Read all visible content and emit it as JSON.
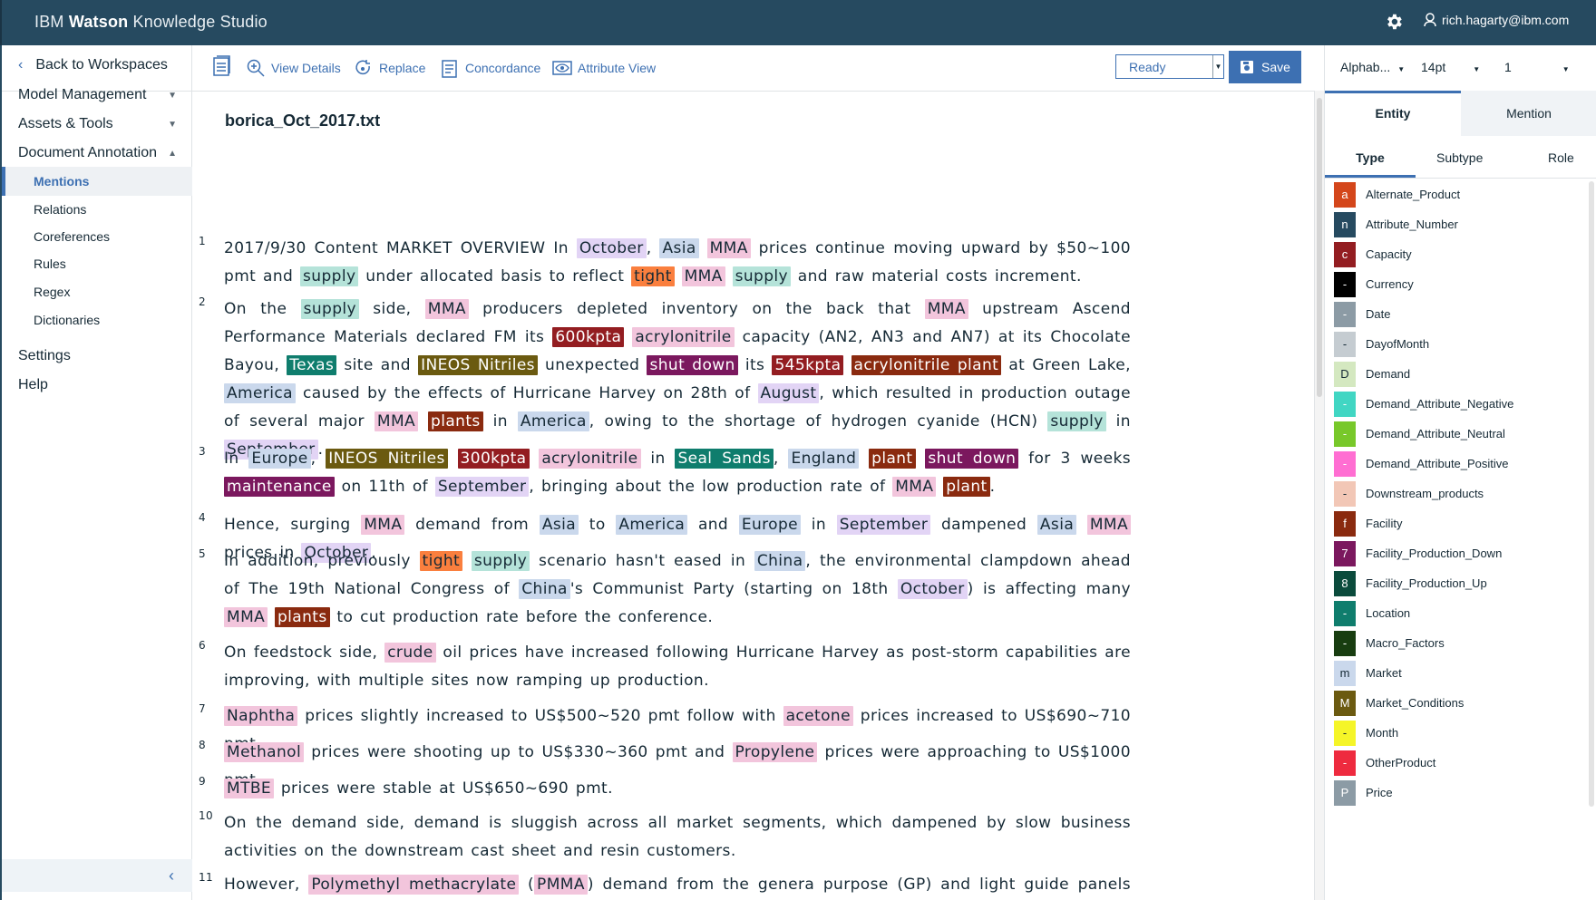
{
  "app": {
    "brand_prefix": "IBM",
    "brand_bold": "Watson",
    "brand_suffix": "Knowledge Studio",
    "user": "rich.hagarty@ibm.com"
  },
  "nav": {
    "back": "Back to Workspaces",
    "sections": [
      {
        "label": "Model Management",
        "expanded": false
      },
      {
        "label": "Assets & Tools",
        "expanded": false
      },
      {
        "label": "Document Annotation",
        "expanded": true
      }
    ],
    "sub_items": [
      "Mentions",
      "Relations",
      "Coreferences",
      "Rules",
      "Regex",
      "Dictionaries"
    ],
    "active_sub": "Mentions",
    "settings": "Settings",
    "help": "Help"
  },
  "toolbar": {
    "view_details": "View Details",
    "replace": "Replace",
    "concordance": "Concordance",
    "attribute_view": "Attribute View",
    "status": "Ready",
    "save": "Save"
  },
  "rp_controls": {
    "sort": "Alphab...",
    "font_size": "14pt",
    "page": "1"
  },
  "rp_tabs": {
    "entity": "Entity",
    "mention": "Mention",
    "type": "Type",
    "subtype": "Subtype",
    "role": "Role"
  },
  "document": {
    "title": "borica_Oct_2017.txt"
  },
  "entity_types": [
    {
      "letter": "a",
      "name": "Alternate_Product",
      "color": "#d4461b"
    },
    {
      "letter": "n",
      "name": "Attribute_Number",
      "color": "#264a60"
    },
    {
      "letter": "c",
      "name": "Capacity",
      "color": "#931d21"
    },
    {
      "letter": "-",
      "name": "Currency",
      "color": "#000000"
    },
    {
      "letter": "-",
      "name": "Date",
      "color": "#8c9ba5"
    },
    {
      "letter": "-",
      "name": "DayofMonth",
      "color": "#c5ccd1"
    },
    {
      "letter": "D",
      "name": "Demand",
      "color": "#d4e8c0"
    },
    {
      "letter": "-",
      "name": "Demand_Attribute_Negative",
      "color": "#41d6c3"
    },
    {
      "letter": "-",
      "name": "Demand_Attribute_Neutral",
      "color": "#78c82a"
    },
    {
      "letter": "-",
      "name": "Demand_Attribute_Positive",
      "color": "#ff6ed2"
    },
    {
      "letter": "-",
      "name": "Downstream_products",
      "color": "#f2c7b6"
    },
    {
      "letter": "f",
      "name": "Facility",
      "color": "#8a2a0f"
    },
    {
      "letter": "7",
      "name": "Facility_Production_Down",
      "color": "#7b185e"
    },
    {
      "letter": "8",
      "name": "Facility_Production_Up",
      "color": "#0b4b3c"
    },
    {
      "letter": "-",
      "name": "Location",
      "color": "#0f7d6d"
    },
    {
      "letter": "-",
      "name": "Macro_Factors",
      "color": "#183d10"
    },
    {
      "letter": "m",
      "name": "Market",
      "color": "#cad8ec"
    },
    {
      "letter": "M",
      "name": "Market_Conditions",
      "color": "#6b5a10"
    },
    {
      "letter": "-",
      "name": "Month",
      "color": "#f5f528"
    },
    {
      "letter": "-",
      "name": "OtherProduct",
      "color": "#ee2b3f"
    },
    {
      "letter": "P",
      "name": "Price",
      "color": "#8c9ba5"
    }
  ],
  "paragraphs": [
    {
      "num": "1",
      "segs": [
        [
          "2017/9/30 Content MARKET OVERVIEW In ",
          ""
        ],
        [
          "October",
          "month"
        ],
        [
          ", ",
          ""
        ],
        [
          "Asia",
          "market"
        ],
        [
          " ",
          ""
        ],
        [
          "MMA",
          "product"
        ],
        [
          " prices continue moving upward by $50~100 pmt and ",
          ""
        ],
        [
          "supply",
          "supply"
        ],
        [
          " under allocated basis to reflect ",
          ""
        ],
        [
          "tight",
          "tight"
        ],
        [
          " ",
          ""
        ],
        [
          "MMA",
          "product"
        ],
        [
          " ",
          ""
        ],
        [
          "supply",
          "supply"
        ],
        [
          " and raw material costs increment.",
          ""
        ]
      ]
    },
    {
      "num": "2",
      "segs": [
        [
          "On the ",
          ""
        ],
        [
          "supply",
          "supply"
        ],
        [
          " side, ",
          ""
        ],
        [
          "MMA",
          "product"
        ],
        [
          " producers depleted inventory on the back that ",
          ""
        ],
        [
          "MMA",
          "product"
        ],
        [
          " upstream Ascend Performance Materials declared FM its ",
          ""
        ],
        [
          "600kpta",
          "capacity"
        ],
        [
          " ",
          ""
        ],
        [
          "acrylonitrile",
          "product"
        ],
        [
          " capacity (AN2, AN3 and AN7) at its Chocolate Bayou, ",
          ""
        ],
        [
          "Texas",
          "location"
        ],
        [
          " site and ",
          ""
        ],
        [
          "INEOS Nitriles",
          "marketcond"
        ],
        [
          " unexpected ",
          ""
        ],
        [
          "shut down",
          "down"
        ],
        [
          " its ",
          ""
        ],
        [
          "545kpta",
          "capacity"
        ],
        [
          " ",
          ""
        ],
        [
          "acrylonitrile plant",
          "facility"
        ],
        [
          " at Green Lake, ",
          ""
        ],
        [
          "America",
          "market"
        ],
        [
          " caused by the effects of Hurricane Harvey on 28th of ",
          ""
        ],
        [
          "August",
          "month"
        ],
        [
          ", which resulted in production outage of several major ",
          ""
        ],
        [
          "MMA",
          "product"
        ],
        [
          " ",
          ""
        ],
        [
          "plants",
          "facility"
        ],
        [
          " in ",
          ""
        ],
        [
          "America",
          "market"
        ],
        [
          ", owing to the shortage of hydrogen cyanide (HCN) ",
          ""
        ],
        [
          "supply",
          "supply"
        ],
        [
          " in ",
          ""
        ],
        [
          "September",
          "month"
        ],
        [
          ".",
          ""
        ]
      ]
    },
    {
      "num": "3",
      "segs": [
        [
          "In ",
          ""
        ],
        [
          "Europe",
          "market"
        ],
        [
          ", ",
          ""
        ],
        [
          "INEOS Nitriles",
          "marketcond"
        ],
        [
          " ",
          ""
        ],
        [
          "300kpta",
          "capacity"
        ],
        [
          " ",
          ""
        ],
        [
          "acrylonitrile",
          "product"
        ],
        [
          " in ",
          ""
        ],
        [
          "Seal Sands",
          "location"
        ],
        [
          ", ",
          ""
        ],
        [
          "England",
          "market"
        ],
        [
          " ",
          ""
        ],
        [
          "plant",
          "facility"
        ],
        [
          " ",
          ""
        ],
        [
          "shut down",
          "down"
        ],
        [
          " for 3 weeks ",
          ""
        ],
        [
          "maintenance",
          "down"
        ],
        [
          " on 11th of ",
          ""
        ],
        [
          "September",
          "month"
        ],
        [
          ", bringing about the low production rate of ",
          ""
        ],
        [
          "MMA",
          "product"
        ],
        [
          " ",
          ""
        ],
        [
          "plant",
          "facility"
        ],
        [
          ".",
          ""
        ]
      ]
    },
    {
      "num": "4",
      "segs": [
        [
          "Hence, surging ",
          ""
        ],
        [
          "MMA",
          "product"
        ],
        [
          " demand from ",
          ""
        ],
        [
          "Asia",
          "market"
        ],
        [
          " to ",
          ""
        ],
        [
          "America",
          "market"
        ],
        [
          " and ",
          ""
        ],
        [
          "Europe",
          "market"
        ],
        [
          " in ",
          ""
        ],
        [
          "September",
          "month"
        ],
        [
          " dampened ",
          ""
        ],
        [
          "Asia",
          "market"
        ],
        [
          " ",
          ""
        ],
        [
          "MMA",
          "product"
        ],
        [
          " prices in ",
          ""
        ],
        [
          "October",
          "month"
        ],
        [
          ".",
          ""
        ]
      ]
    },
    {
      "num": "5",
      "segs": [
        [
          "In addition, previously ",
          ""
        ],
        [
          "tight",
          "tight"
        ],
        [
          " ",
          ""
        ],
        [
          "supply",
          "supply"
        ],
        [
          " scenario has​n't eased in ",
          ""
        ],
        [
          "China",
          "market"
        ],
        [
          ", the environmental clampdown ahead of The 19th National Congress of ",
          ""
        ],
        [
          "China",
          "market"
        ],
        [
          "'s Communist Party (starting on 18th ",
          ""
        ],
        [
          "October",
          "month"
        ],
        [
          ") is affecting many ",
          ""
        ],
        [
          "MMA",
          "product"
        ],
        [
          " ",
          ""
        ],
        [
          "plants",
          "facility"
        ],
        [
          " to cut production rate before the conference.",
          ""
        ]
      ]
    },
    {
      "num": "6",
      "segs": [
        [
          "On feedstock side, ",
          ""
        ],
        [
          "crude",
          "product"
        ],
        [
          " oil prices have increased following Hurricane Harvey as post-storm capabilities are improving, with multiple sites now ramping up production.",
          ""
        ]
      ]
    },
    {
      "num": "7",
      "segs": [
        [
          "Naphtha",
          "product"
        ],
        [
          " prices slightly increased to US$500~520 pmt follow with ",
          ""
        ],
        [
          "acetone",
          "product"
        ],
        [
          " prices increased to US$690~710 pmt.",
          ""
        ]
      ]
    },
    {
      "num": "8",
      "segs": [
        [
          "Methanol",
          "product"
        ],
        [
          " prices were shooting up to US$330~360 pmt and ",
          ""
        ],
        [
          "Propylene",
          "product"
        ],
        [
          " prices were approaching to US$1000 pmt.",
          ""
        ]
      ]
    },
    {
      "num": "9",
      "segs": [
        [
          "MTBE",
          "product"
        ],
        [
          " prices were stable at US$650~690 pmt.",
          ""
        ]
      ]
    },
    {
      "num": "10",
      "segs": [
        [
          "On the demand side, demand is sluggish across all market segments, which dampened by slow business activities on the downstream cast sheet and resin customers.",
          ""
        ]
      ]
    },
    {
      "num": "11",
      "segs": [
        [
          "However, ",
          ""
        ],
        [
          "Polymethyl methacrylate",
          "product"
        ],
        [
          " (",
          ""
        ],
        [
          "PMMA",
          "product"
        ],
        [
          ") demand from the genera purpose (GP) and light guide panels (LGP) grade",
          ""
        ]
      ]
    }
  ]
}
